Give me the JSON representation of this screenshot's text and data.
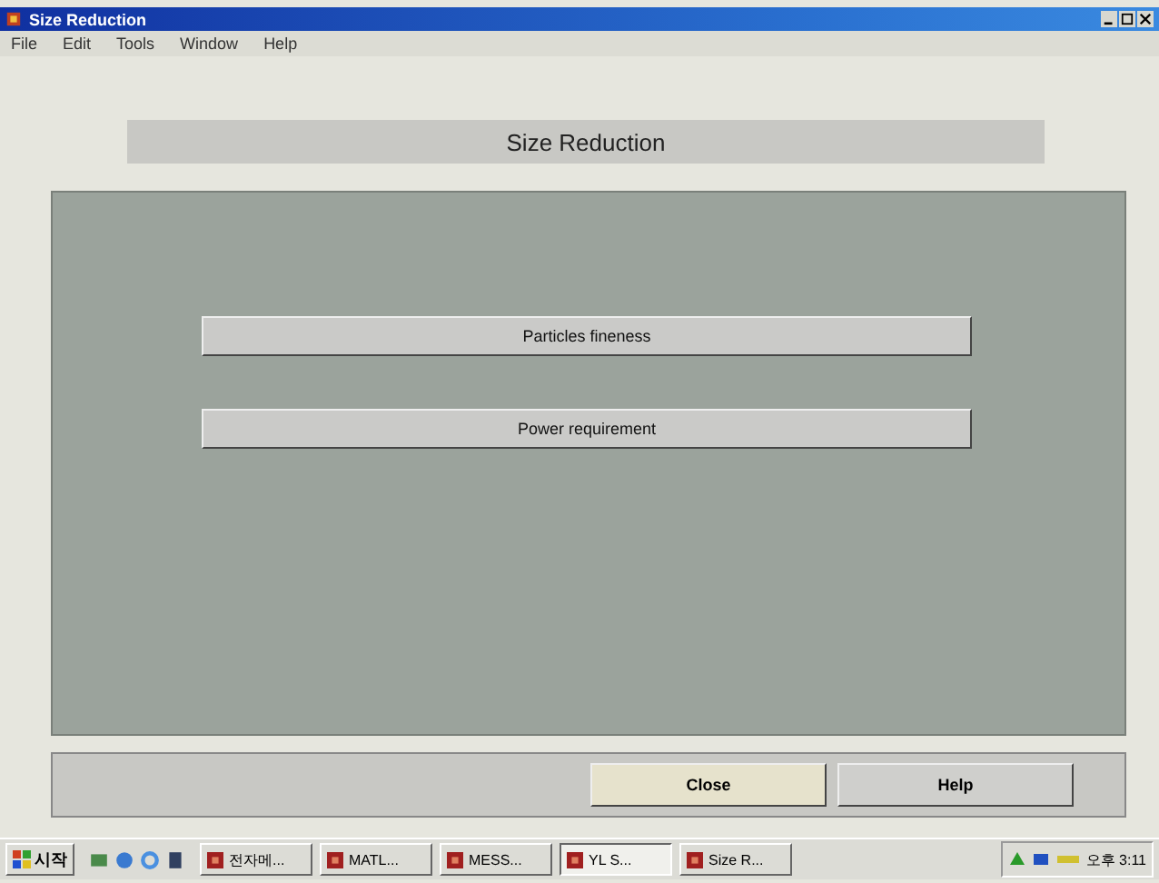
{
  "window": {
    "title": "Size Reduction"
  },
  "menu": [
    "File",
    "Edit",
    "Tools",
    "Window",
    "Help"
  ],
  "header": {
    "title": "Size Reduction"
  },
  "options": [
    {
      "label": "Particles fineness"
    },
    {
      "label": "Power requirement"
    }
  ],
  "buttons": [
    {
      "label": "Close",
      "selected": true
    },
    {
      "label": "Help",
      "selected": false
    }
  ],
  "taskbar": {
    "start": "시작",
    "tasks": [
      {
        "label": "전자메...",
        "selected": false
      },
      {
        "label": "MATL...",
        "selected": false
      },
      {
        "label": "MESS...",
        "selected": false
      },
      {
        "label": "YL S...",
        "selected": true
      },
      {
        "label": "Size R...",
        "selected": false
      }
    ],
    "clock": "오후 3:11"
  }
}
